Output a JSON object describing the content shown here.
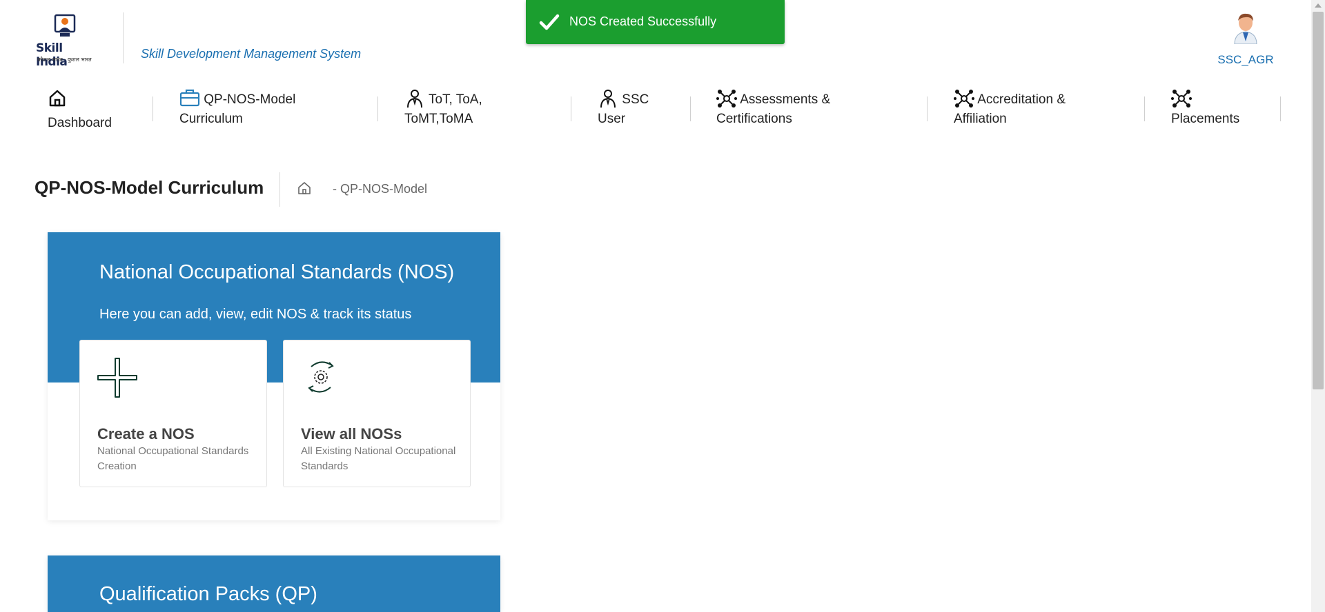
{
  "header": {
    "logo_text": "Skill India",
    "logo_tagline": "कौशल भारत - कुशल भारत",
    "system_title": "Skill Development Management System",
    "user_name": "SSC_AGR"
  },
  "toast": {
    "message": "NOS Created Successfully",
    "color": "#1b9e2f"
  },
  "nav": [
    {
      "line1": "",
      "line2": "Dashboard",
      "icon": "home-icon"
    },
    {
      "line1": "QP-NOS-Model",
      "line2": "Curriculum",
      "icon": "briefcase-icon"
    },
    {
      "line1": "ToT, ToA,",
      "line2": "ToMT,ToMA",
      "icon": "trainer-icon"
    },
    {
      "line1": "SSC",
      "line2": "User",
      "icon": "user-icon"
    },
    {
      "line1": "Assessments &",
      "line2": "Certifications",
      "icon": "network-icon"
    },
    {
      "line1": "Accreditation &",
      "line2": "Affiliation",
      "icon": "network-icon"
    },
    {
      "line1": "",
      "line2": "Placements",
      "icon": "network-icon"
    }
  ],
  "page": {
    "title": "QP-NOS-Model Curriculum",
    "breadcrumb": "-  QP-NOS-Model"
  },
  "nos_section": {
    "heading": "National Occupational Standards (NOS)",
    "sub": "Here you can add, view, edit NOS & track its status",
    "cards": [
      {
        "title": "Create a NOS",
        "desc": "National Occupational Standards Creation",
        "icon": "plus-icon"
      },
      {
        "title": "View all NOSs",
        "desc": "All Existing National Occupational Standards",
        "icon": "gear-sync-icon"
      }
    ]
  },
  "qp_section": {
    "heading": "Qualification Packs (QP)"
  },
  "colors": {
    "primary": "#2980bb",
    "link": "#1a6fb0",
    "success": "#1b9e2f"
  }
}
